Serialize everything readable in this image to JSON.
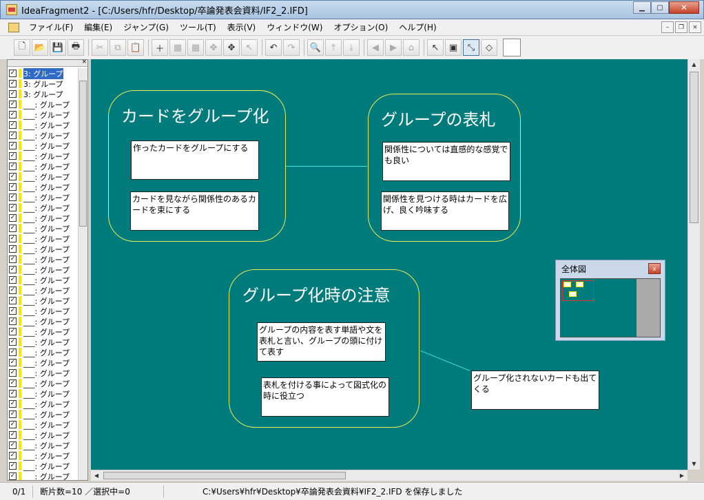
{
  "window": {
    "title": "IdeaFragment2 - [C:/Users/hfr/Desktop/卒論発表会資料/IF2_2.IFD]",
    "minimize": "▁",
    "maximize": "▢",
    "close": "✕"
  },
  "menu": {
    "items": [
      "ファイル(F)",
      "編集(E)",
      "ジャンプ(G)",
      "ツール(T)",
      "表示(V)",
      "ウィンドウ(W)",
      "オプション(O)",
      "ヘルプ(H)"
    ],
    "mdi_minimize": "–",
    "mdi_restore": "❐",
    "mdi_close": "×"
  },
  "toolbar": {
    "new": "🗋",
    "open": "📂",
    "save": "💾",
    "print": "🖶",
    "cut": "✂",
    "copy": "⧉",
    "paste": "📋",
    "add_card": "＋",
    "grid1": "▦",
    "grid2": "▦",
    "move": "✥",
    "arrange": "✥",
    "select_arrow": "↖",
    "undo": "↶",
    "redo": "↷",
    "find": "🔍",
    "top": "⤒",
    "bottom": "⤓",
    "back": "◀",
    "forward": "▶",
    "home": "⌂",
    "pointer": "↖",
    "group": "▣",
    "link": "⤡",
    "fill": "◇"
  },
  "sidebar": {
    "close": "×",
    "items": [
      {
        "label": "3: グループ",
        "selected": true
      },
      {
        "label": "3: グループ"
      },
      {
        "label": "3: グループ"
      },
      {
        "label": "___: グループ"
      },
      {
        "label": "___: グループ"
      },
      {
        "label": "___: グループ"
      },
      {
        "label": "___: グループ"
      },
      {
        "label": "___: グループ"
      },
      {
        "label": "___: グループ"
      },
      {
        "label": "___: グループ"
      },
      {
        "label": "___: グループ"
      },
      {
        "label": "___: グループ"
      },
      {
        "label": "___: グループ"
      },
      {
        "label": "___: グループ"
      },
      {
        "label": "___: グループ"
      },
      {
        "label": "___: グループ"
      },
      {
        "label": "___: グループ"
      },
      {
        "label": "___: グループ"
      },
      {
        "label": "___: グループ"
      },
      {
        "label": "___: グループ"
      },
      {
        "label": "___: グループ"
      },
      {
        "label": "___: グループ"
      },
      {
        "label": "___: グループ"
      },
      {
        "label": "___: グループ"
      },
      {
        "label": "___: グループ"
      },
      {
        "label": "___: グループ"
      },
      {
        "label": "___: グループ"
      },
      {
        "label": "___: グループ"
      },
      {
        "label": "___: グループ"
      },
      {
        "label": "___: グループ"
      },
      {
        "label": "___: グループ"
      },
      {
        "label": "___: グループ"
      },
      {
        "label": "___: グループ"
      },
      {
        "label": "___: グループ"
      },
      {
        "label": "___: グループ"
      },
      {
        "label": "___: グループ"
      },
      {
        "label": "___: グループ"
      },
      {
        "label": "___: グループ"
      },
      {
        "label": "___: グループ"
      },
      {
        "label": "___: グループ"
      }
    ]
  },
  "canvas": {
    "groups": [
      {
        "title": "カードをグループ化",
        "cards": [
          "作ったカードをグループにする",
          "カードを見ながら関係性のあるカードを束にする"
        ]
      },
      {
        "title": "グループの表札",
        "cards": [
          "関係性については直感的な感覚でも良い",
          "関係性を見つける時はカードを広げ、良く吟味する"
        ]
      },
      {
        "title": "グループ化時の注意",
        "cards": [
          "グループの内容を表す単語や文を表札と言い、グループの頭に付けて表す",
          "表札を付ける事によって図式化の時に役立つ"
        ]
      }
    ],
    "loose_card": "グループ化されないカードも出てくる"
  },
  "overview": {
    "title": "全体図",
    "close": "x"
  },
  "status": {
    "position": "0/1",
    "counts": "断片数=10 ／選択中=0",
    "message": "C:¥Users¥hfr¥Desktop¥卒論発表会資料¥IF2_2.IFD を保存しました"
  },
  "colors": {
    "canvas_bg": "#007b7b",
    "group_border": "#e8ef56",
    "link_line": "#42e6e6"
  }
}
